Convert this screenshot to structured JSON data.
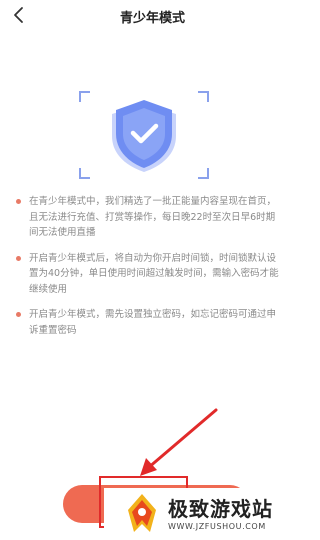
{
  "header": {
    "title": "青少年模式"
  },
  "notices": [
    "在青少年模式中，我们精选了一批正能量内容呈现在首页，且无法进行充值、打赏等操作，每日晚22时至次日早6时期间无法使用直播",
    "开启青少年模式后，将自动为你开启时间锁，时间锁默认设置为40分钟，单日使用时间超过触发时间，需输入密码才能继续使用",
    "开启青少年模式，需先设置独立密码，如忘记密码可通过申诉重置密码"
  ],
  "open_button_label": "",
  "watermark": {
    "title": "极致游戏站",
    "url": "WWW.JZFUSHOU.COM"
  },
  "colors": {
    "accent": "#ef6a52",
    "shield": "#6f8df2",
    "bullet": "#e87a66",
    "annotation": "#e12a2a"
  },
  "icons": {
    "back": "chevron-left-icon",
    "hero": "shield-check-icon",
    "watermark_logo": "game-logo-icon"
  }
}
